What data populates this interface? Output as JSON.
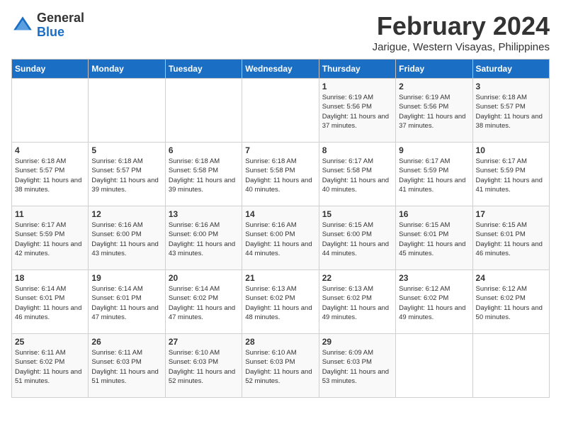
{
  "logo": {
    "general": "General",
    "blue": "Blue"
  },
  "title": {
    "month": "February 2024",
    "location": "Jarigue, Western Visayas, Philippines"
  },
  "headers": [
    "Sunday",
    "Monday",
    "Tuesday",
    "Wednesday",
    "Thursday",
    "Friday",
    "Saturday"
  ],
  "weeks": [
    [
      {
        "day": "",
        "info": ""
      },
      {
        "day": "",
        "info": ""
      },
      {
        "day": "",
        "info": ""
      },
      {
        "day": "",
        "info": ""
      },
      {
        "day": "1",
        "info": "Sunrise: 6:19 AM\nSunset: 5:56 PM\nDaylight: 11 hours\nand 37 minutes."
      },
      {
        "day": "2",
        "info": "Sunrise: 6:19 AM\nSunset: 5:56 PM\nDaylight: 11 hours\nand 37 minutes."
      },
      {
        "day": "3",
        "info": "Sunrise: 6:18 AM\nSunset: 5:57 PM\nDaylight: 11 hours\nand 38 minutes."
      }
    ],
    [
      {
        "day": "4",
        "info": "Sunrise: 6:18 AM\nSunset: 5:57 PM\nDaylight: 11 hours\nand 38 minutes."
      },
      {
        "day": "5",
        "info": "Sunrise: 6:18 AM\nSunset: 5:57 PM\nDaylight: 11 hours\nand 39 minutes."
      },
      {
        "day": "6",
        "info": "Sunrise: 6:18 AM\nSunset: 5:58 PM\nDaylight: 11 hours\nand 39 minutes."
      },
      {
        "day": "7",
        "info": "Sunrise: 6:18 AM\nSunset: 5:58 PM\nDaylight: 11 hours\nand 40 minutes."
      },
      {
        "day": "8",
        "info": "Sunrise: 6:17 AM\nSunset: 5:58 PM\nDaylight: 11 hours\nand 40 minutes."
      },
      {
        "day": "9",
        "info": "Sunrise: 6:17 AM\nSunset: 5:59 PM\nDaylight: 11 hours\nand 41 minutes."
      },
      {
        "day": "10",
        "info": "Sunrise: 6:17 AM\nSunset: 5:59 PM\nDaylight: 11 hours\nand 41 minutes."
      }
    ],
    [
      {
        "day": "11",
        "info": "Sunrise: 6:17 AM\nSunset: 5:59 PM\nDaylight: 11 hours\nand 42 minutes."
      },
      {
        "day": "12",
        "info": "Sunrise: 6:16 AM\nSunset: 6:00 PM\nDaylight: 11 hours\nand 43 minutes."
      },
      {
        "day": "13",
        "info": "Sunrise: 6:16 AM\nSunset: 6:00 PM\nDaylight: 11 hours\nand 43 minutes."
      },
      {
        "day": "14",
        "info": "Sunrise: 6:16 AM\nSunset: 6:00 PM\nDaylight: 11 hours\nand 44 minutes."
      },
      {
        "day": "15",
        "info": "Sunrise: 6:15 AM\nSunset: 6:00 PM\nDaylight: 11 hours\nand 44 minutes."
      },
      {
        "day": "16",
        "info": "Sunrise: 6:15 AM\nSunset: 6:01 PM\nDaylight: 11 hours\nand 45 minutes."
      },
      {
        "day": "17",
        "info": "Sunrise: 6:15 AM\nSunset: 6:01 PM\nDaylight: 11 hours\nand 46 minutes."
      }
    ],
    [
      {
        "day": "18",
        "info": "Sunrise: 6:14 AM\nSunset: 6:01 PM\nDaylight: 11 hours\nand 46 minutes."
      },
      {
        "day": "19",
        "info": "Sunrise: 6:14 AM\nSunset: 6:01 PM\nDaylight: 11 hours\nand 47 minutes."
      },
      {
        "day": "20",
        "info": "Sunrise: 6:14 AM\nSunset: 6:02 PM\nDaylight: 11 hours\nand 47 minutes."
      },
      {
        "day": "21",
        "info": "Sunrise: 6:13 AM\nSunset: 6:02 PM\nDaylight: 11 hours\nand 48 minutes."
      },
      {
        "day": "22",
        "info": "Sunrise: 6:13 AM\nSunset: 6:02 PM\nDaylight: 11 hours\nand 49 minutes."
      },
      {
        "day": "23",
        "info": "Sunrise: 6:12 AM\nSunset: 6:02 PM\nDaylight: 11 hours\nand 49 minutes."
      },
      {
        "day": "24",
        "info": "Sunrise: 6:12 AM\nSunset: 6:02 PM\nDaylight: 11 hours\nand 50 minutes."
      }
    ],
    [
      {
        "day": "25",
        "info": "Sunrise: 6:11 AM\nSunset: 6:02 PM\nDaylight: 11 hours\nand 51 minutes."
      },
      {
        "day": "26",
        "info": "Sunrise: 6:11 AM\nSunset: 6:03 PM\nDaylight: 11 hours\nand 51 minutes."
      },
      {
        "day": "27",
        "info": "Sunrise: 6:10 AM\nSunset: 6:03 PM\nDaylight: 11 hours\nand 52 minutes."
      },
      {
        "day": "28",
        "info": "Sunrise: 6:10 AM\nSunset: 6:03 PM\nDaylight: 11 hours\nand 52 minutes."
      },
      {
        "day": "29",
        "info": "Sunrise: 6:09 AM\nSunset: 6:03 PM\nDaylight: 11 hours\nand 53 minutes."
      },
      {
        "day": "",
        "info": ""
      },
      {
        "day": "",
        "info": ""
      }
    ]
  ]
}
